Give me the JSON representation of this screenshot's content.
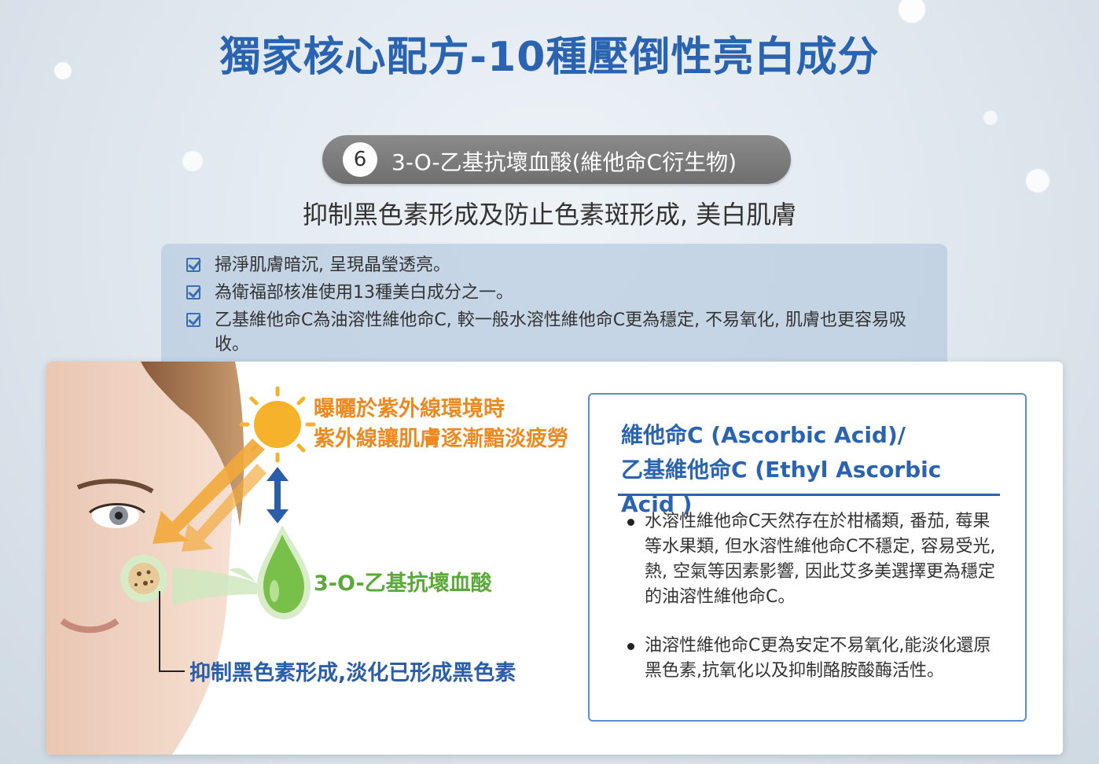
{
  "title": "獨家核心配方-10種壓倒性亮白成分",
  "badge": {
    "number": "6",
    "label": "3-O-乙基抗壞血酸(維他命C衍生物)"
  },
  "subtitle": "抑制黑色素形成及防止色素斑形成, 美白肌膚",
  "bullets": [
    "掃淨肌膚暗沉, 呈現晶瑩透亮。",
    "為衛福部核准使用13種美白成分之一。",
    "乙基維他命C為油溶性維他命C, 較一般水溶性維他命C更為穩定, 不易氧化, 肌膚也更容易吸收。"
  ],
  "diagram": {
    "uv_line1": "曝曬於紫外線環境時",
    "uv_line2": "紫外線讓肌膚逐漸黯淡疲勞",
    "ingredient": "3-O-乙基抗壞血酸",
    "inhibit": "抑制黑色素形成,淡化已形成黑色素"
  },
  "info": {
    "title_line1": "維他命C (Ascorbic Acid)/",
    "title_line2": "乙基維他命C (Ethyl Ascorbic Acid )",
    "items": [
      "水溶性維他命C天然存在於柑橘類, 番茄, 莓果等水果類, 但水溶性維他命C不穩定, 容易受光, 熱, 空氣等因素影響, 因此艾多美選擇更為穩定的油溶性維他命C。",
      "油溶性維他命C更為安定不易氧化,能淡化還原黑色素,抗氧化以及抑制酪胺酸酶活性。"
    ]
  },
  "colors": {
    "title_blue": "#2a64b0",
    "orange": "#ec8a22",
    "green": "#5aa93a"
  }
}
